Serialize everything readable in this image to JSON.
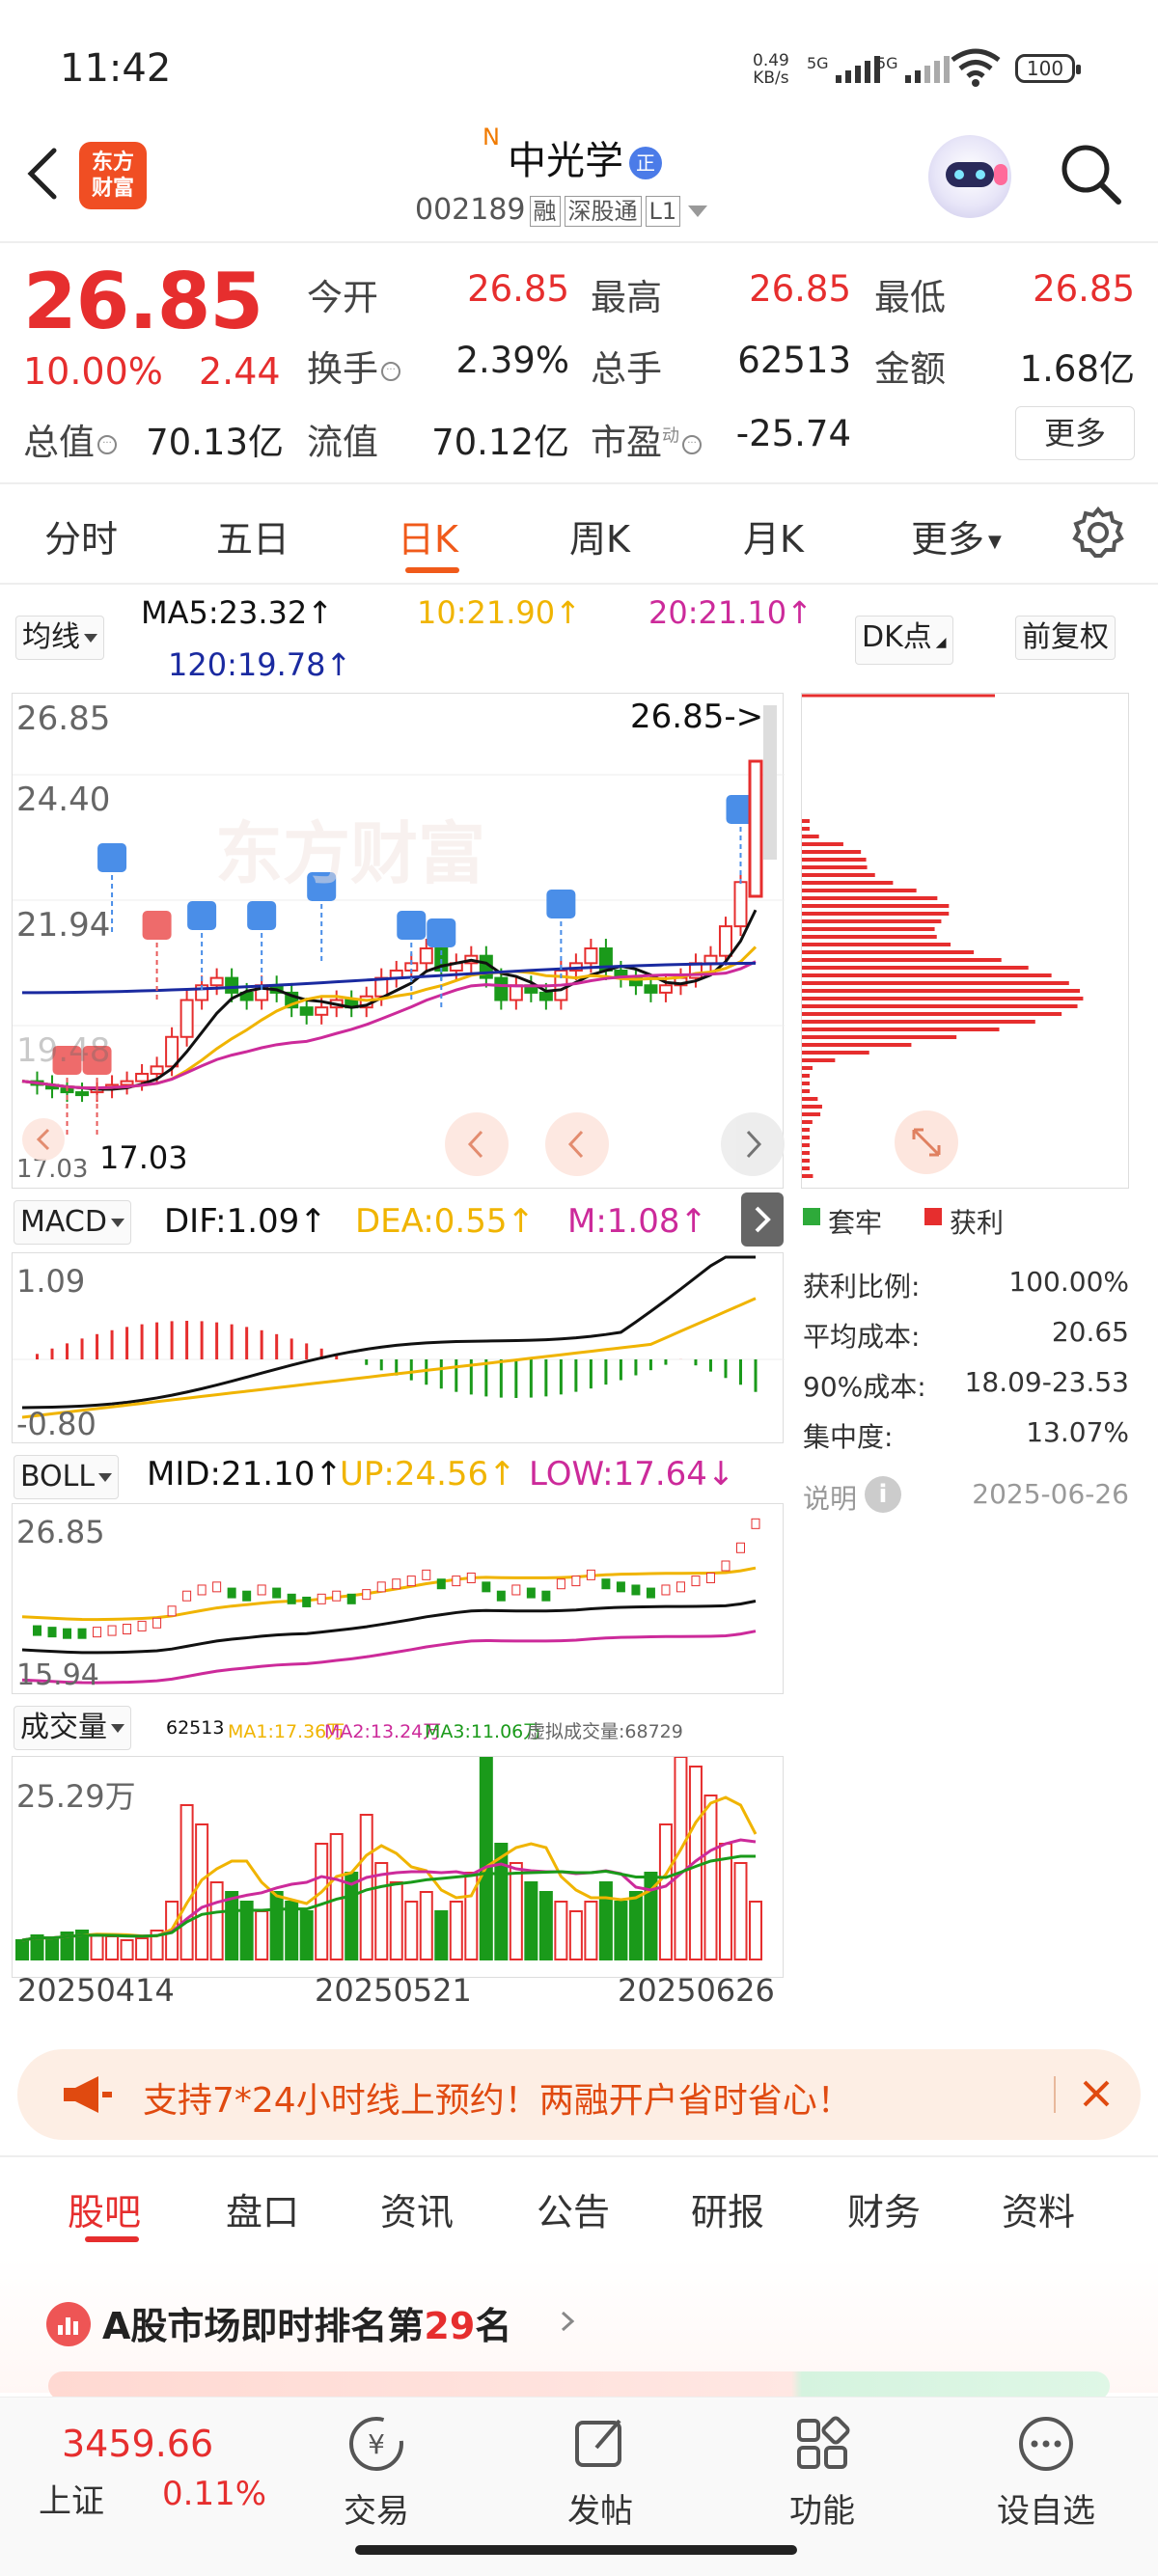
{
  "status_bar": {
    "time": "11:42",
    "net_speed": "0.49",
    "net_unit": "KB/s",
    "sim1": "5G",
    "sim2": "5G",
    "battery": "100"
  },
  "header": {
    "logo_line1": "东方",
    "logo_line2": "财富",
    "new_mark": "N",
    "stock_name": "中光学",
    "badge": "正",
    "code": "002189",
    "tags": [
      "融",
      "深股通",
      "L1"
    ]
  },
  "quote": {
    "price": "26.85",
    "change_pct": "10.00%",
    "change": "2.44",
    "stats": [
      {
        "label": "今开",
        "value": "26.85",
        "color": "red"
      },
      {
        "label": "最高",
        "value": "26.85",
        "color": "red"
      },
      {
        "label": "最低",
        "value": "26.85",
        "color": "red"
      },
      {
        "label": "换手",
        "value": "2.39%",
        "color": "black"
      },
      {
        "label": "总手",
        "value": "62513",
        "color": "black"
      },
      {
        "label": "金额",
        "value": "1.68亿",
        "color": "black"
      },
      {
        "label": "总值",
        "value": "70.13亿",
        "color": "black"
      },
      {
        "label": "流值",
        "value": "70.12亿",
        "color": "black"
      },
      {
        "label": "市盈",
        "value": "-25.74",
        "color": "black"
      }
    ],
    "pe_superscript": "动",
    "more": "更多"
  },
  "period_tabs": [
    "分时",
    "五日",
    "日K",
    "周K",
    "月K",
    "更多"
  ],
  "active_period": "日K",
  "ma_bar": {
    "selector": "均线",
    "ma5": "MA5:23.32",
    "ma10": "10:21.90",
    "ma20": "20:21.10",
    "ma120": "120:19.78",
    "arrow": "↑",
    "dk_button": "DK点",
    "adjust_button": "前复权"
  },
  "kline": {
    "y_top": "26.85",
    "y_2": "24.40",
    "y_3": "21.94",
    "y_4": "19.48",
    "y_bottom": "17.03",
    "last_price_tag": "26.85->",
    "low_marker": "17.03",
    "watermark": "东方财富"
  },
  "chip": {
    "legend_trapped": "套牢",
    "legend_profit": "获利",
    "rows": [
      {
        "label": "获利比例:",
        "value": "100.00%"
      },
      {
        "label": "平均成本:",
        "value": "20.65"
      },
      {
        "label": "90%成本:",
        "value": "18.09-23.53"
      },
      {
        "label": "集中度:",
        "value": "13.07%"
      }
    ],
    "note_label": "说明",
    "date": "2025-06-26"
  },
  "macd": {
    "selector": "MACD",
    "dif": "DIF:1.09",
    "dea": "DEA:0.55",
    "m": "M:1.08",
    "y_top": "1.09",
    "y_bottom": "-0.80"
  },
  "boll": {
    "selector": "BOLL",
    "mid": "MID:21.10",
    "up": "UP:24.56",
    "low": "LOW:17.64",
    "y_top": "26.85",
    "y_bottom": "15.94"
  },
  "volume": {
    "selector": "成交量",
    "vol": "62513",
    "ma1": "MA1:17.36万",
    "ma2": "MA2:13.24万",
    "ma3": "MA3:11.06万",
    "virtual": "虚拟成交量:68729",
    "y_top": "25.29万",
    "dates": [
      "20250414",
      "20250521",
      "20250626"
    ]
  },
  "banner": {
    "text": "支持7*24小时线上预约！两融开户省时省心！"
  },
  "bottom_tabs": [
    "股吧",
    "盘口",
    "资讯",
    "公告",
    "研报",
    "财务",
    "资料"
  ],
  "active_bottom_tab": "股吧",
  "ranking": {
    "prefix": "A股市场即时排名第",
    "rank": "29",
    "suffix": "名"
  },
  "bottom_nav": {
    "index_value": "3459.66",
    "index_name": "上证",
    "index_pct": "0.11%",
    "items": [
      "交易",
      "发帖",
      "功能",
      "设自选"
    ]
  },
  "colors": {
    "up": "#e62e2e",
    "down": "#1a9a1a",
    "accent": "#f05a1a",
    "ma5": "#111111",
    "ma10": "#f0b400",
    "ma20": "#cc2a9a",
    "ma120": "#1a2aa0"
  }
}
